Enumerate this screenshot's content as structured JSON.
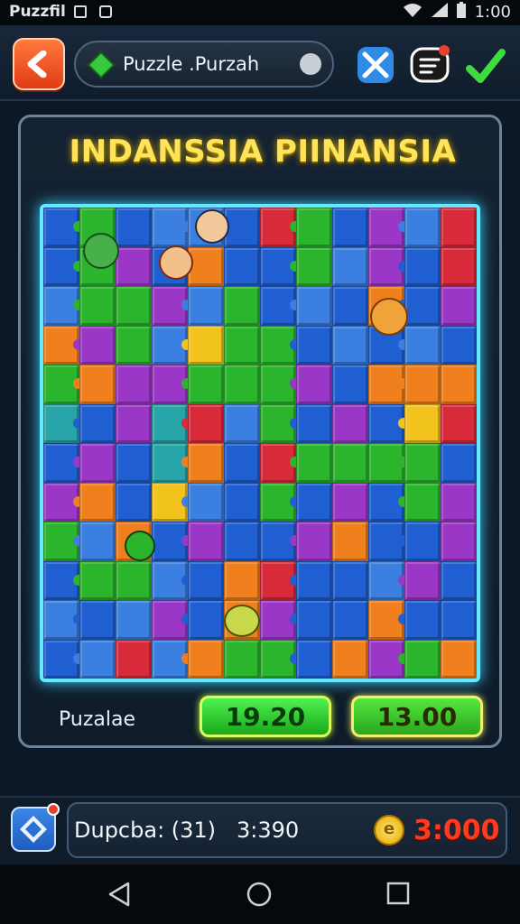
{
  "status_bar": {
    "app_label": "Puzzfil",
    "time": "1:00"
  },
  "header": {
    "title": "Puzzle .Purzah",
    "back_icon": "back-arrow-icon",
    "icons": [
      "tools-icon",
      "chat-icon",
      "checkmark-icon"
    ]
  },
  "level": {
    "title": "INDANSSIA PIINANSIA"
  },
  "puzzle": {
    "label": "Puzalae",
    "score_a": "19.20",
    "score_b": "13.00"
  },
  "bottom_bar": {
    "status_text": "Dupcba: (31)",
    "time": "3:390",
    "coin_symbol": "e",
    "coins": "3:000"
  },
  "colors": {
    "accent_glow": "#66e8ff",
    "title_yellow": "#ffe35a",
    "coins_red": "#ff3a1e",
    "pieces": [
      "#1f5fd1",
      "#2bb52d",
      "#9b37c7",
      "#f07f1e",
      "#d92a3a",
      "#f2c31d",
      "#27a5a8",
      "#3b7fe0"
    ]
  }
}
